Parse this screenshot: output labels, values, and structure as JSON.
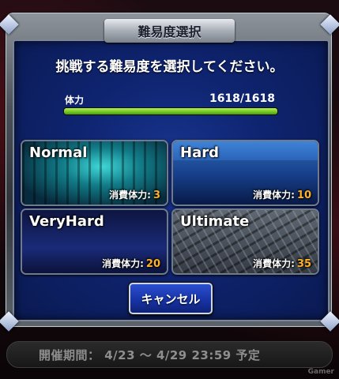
{
  "dialog": {
    "title": "難易度選択",
    "prompt": "挑戦する難易度を選択してください。"
  },
  "stamina": {
    "label": "体力",
    "value": "1618/1618",
    "fill_percent": 100
  },
  "difficulties": [
    {
      "name": "Normal",
      "cost_label": "消費体力:",
      "cost": "3"
    },
    {
      "name": "Hard",
      "cost_label": "消費体力:",
      "cost": "10"
    },
    {
      "name": "VeryHard",
      "cost_label": "消費体力:",
      "cost": "20"
    },
    {
      "name": "Ultimate",
      "cost_label": "消費体力:",
      "cost": "35"
    }
  ],
  "cancel_label": "キャンセル",
  "event_period": "開催期間： 4/23 〜 4/29 23:59 予定",
  "watermark": "Gamer",
  "colors": {
    "panel_blue": "#0f2470",
    "cost_orange": "#ffb126",
    "stamina_green": "#6ec71f"
  }
}
